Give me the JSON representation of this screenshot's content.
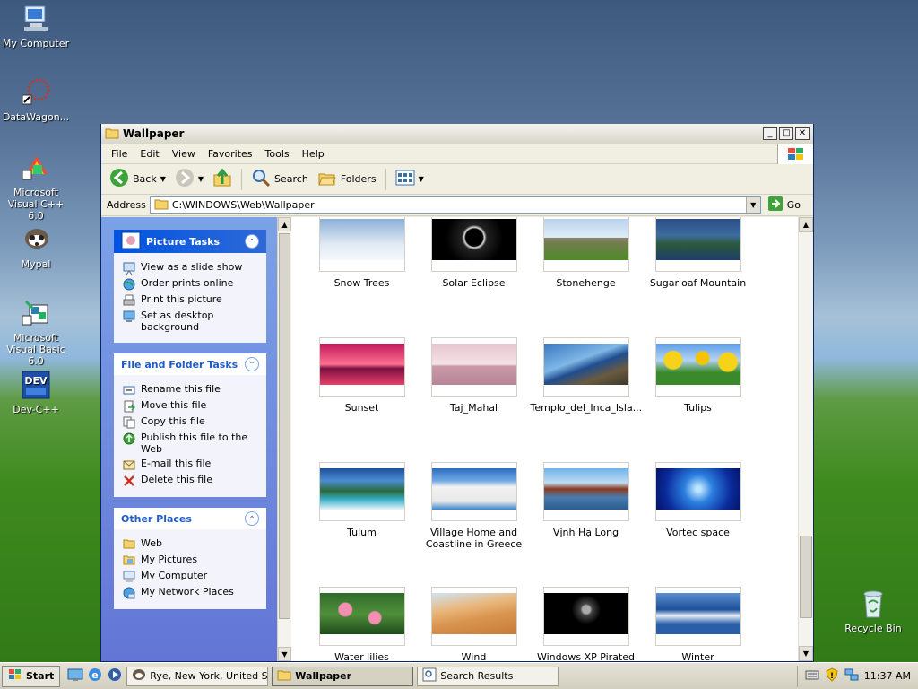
{
  "desktop": {
    "icons": [
      {
        "label": "My Computer",
        "icon": "my-computer-icon"
      },
      {
        "label": "DataWagon...",
        "icon": "datawagon-icon"
      },
      {
        "label": "Microsoft Visual C++ 6.0",
        "icon": "visual-cpp-icon"
      },
      {
        "label": "Mypal",
        "icon": "mypal-icon"
      },
      {
        "label": "Microsoft Visual Basic 6.0",
        "icon": "visual-basic-icon"
      },
      {
        "label": "Dev-C++",
        "icon": "dev-cpp-icon"
      },
      {
        "label": "Recycle Bin",
        "icon": "recycle-bin-icon"
      }
    ]
  },
  "window": {
    "title": "Wallpaper",
    "menu": [
      "File",
      "Edit",
      "View",
      "Favorites",
      "Tools",
      "Help"
    ],
    "toolbar": {
      "back": "Back",
      "search": "Search",
      "folders": "Folders"
    },
    "address": {
      "label": "Address",
      "value": "C:\\WINDOWS\\Web\\Wallpaper",
      "go": "Go"
    }
  },
  "tasks": {
    "picture": {
      "title": "Picture Tasks",
      "items": [
        "View as a slide show",
        "Order prints online",
        "Print this picture",
        "Set as desktop background"
      ]
    },
    "file": {
      "title": "File and Folder Tasks",
      "items": [
        "Rename this file",
        "Move this file",
        "Copy this file",
        "Publish this file to the Web",
        "E-mail this file",
        "Delete this file"
      ]
    },
    "other": {
      "title": "Other Places",
      "items": [
        "Web",
        "My Pictures",
        "My Computer",
        "My Network Places"
      ]
    }
  },
  "files": [
    {
      "name": "Snow Trees"
    },
    {
      "name": "Solar Eclipse"
    },
    {
      "name": "Stonehenge"
    },
    {
      "name": "Sugarloaf Mountain"
    },
    {
      "name": "Sunset"
    },
    {
      "name": "Taj_Mahal"
    },
    {
      "name": "Templo_del_Inca_Isla..."
    },
    {
      "name": "Tulips"
    },
    {
      "name": "Tulum"
    },
    {
      "name": "Village Home and Coastline in Greece"
    },
    {
      "name": "Vịnh Hạ Long"
    },
    {
      "name": "Vortec space"
    },
    {
      "name": "Water lilies"
    },
    {
      "name": "Wind"
    },
    {
      "name": "Windows XP Pirated"
    },
    {
      "name": "Winter"
    }
  ],
  "taskbar": {
    "start": "Start",
    "tasks": [
      "Rye, New York, United S...",
      "Wallpaper",
      "Search Results"
    ],
    "clock": "11:37 AM"
  }
}
